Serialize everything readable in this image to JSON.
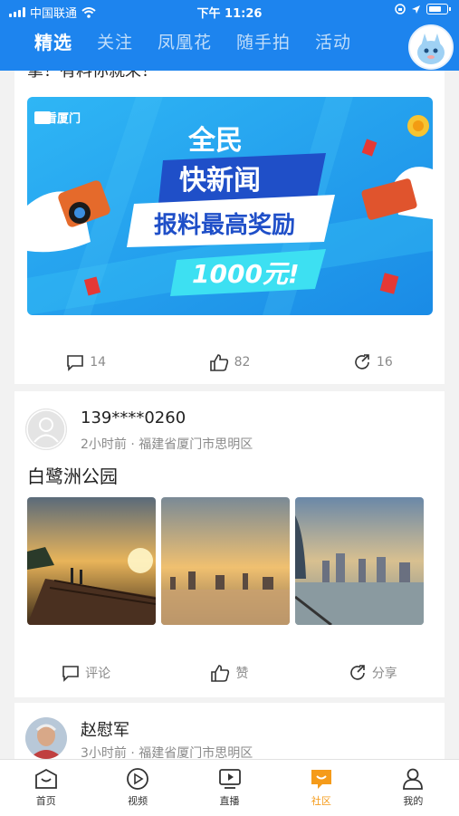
{
  "status_bar": {
    "carrier": "中国联通",
    "time": "下午 11:26"
  },
  "top_tabs": [
    {
      "label": "精选",
      "active": true
    },
    {
      "label": "关注",
      "active": false
    },
    {
      "label": "凤凰花",
      "active": false
    },
    {
      "label": "随手拍",
      "active": false
    },
    {
      "label": "活动",
      "active": false
    }
  ],
  "feed": {
    "card1": {
      "clipped_text": "掌！有料你就来！",
      "banner": {
        "logo": "看厦门",
        "line1": "全民",
        "line2": "快新闻",
        "line3": "报料最高奖励",
        "line4": "1000元!"
      },
      "comments": "14",
      "likes": "82",
      "shares": "16"
    },
    "card2": {
      "username": "139****0260",
      "meta": "2小时前 · 福建省厦门市思明区",
      "title": "白鹭洲公园",
      "comment_label": "评论",
      "like_label": "赞",
      "share_label": "分享"
    },
    "card3": {
      "username": "赵慰军",
      "meta": "3小时前 · 福建省厦门市思明区"
    }
  },
  "bottom_nav": [
    {
      "label": "首页",
      "icon": "home-icon",
      "active": false
    },
    {
      "label": "视频",
      "icon": "play-icon",
      "active": false
    },
    {
      "label": "直播",
      "icon": "tv-icon",
      "active": false
    },
    {
      "label": "社区",
      "icon": "community-icon",
      "active": true
    },
    {
      "label": "我的",
      "icon": "person-icon",
      "active": false
    }
  ],
  "colors": {
    "header_blue": "#1d84ee",
    "active_orange": "#f59b1a",
    "gray_text": "#8b8b8b"
  }
}
